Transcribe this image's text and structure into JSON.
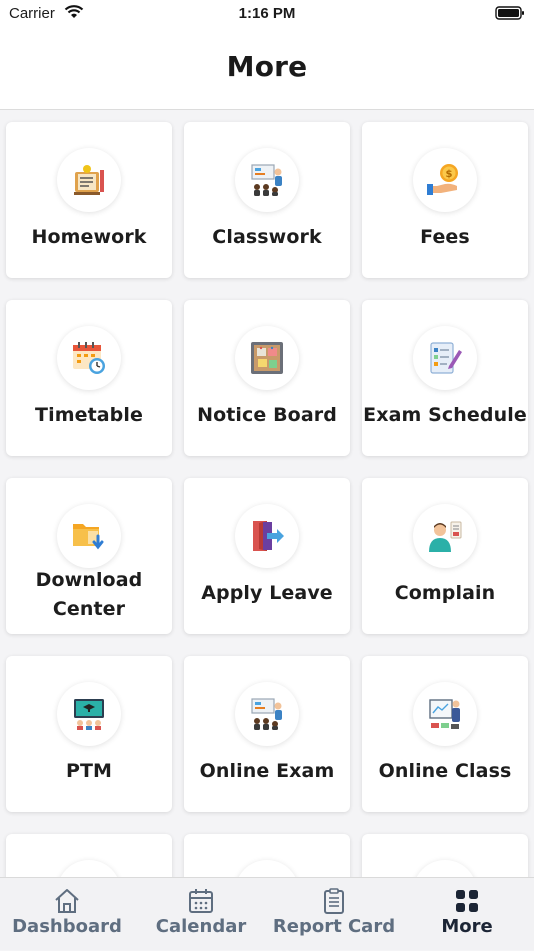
{
  "status_bar": {
    "carrier": "Carrier",
    "time": "1:16 PM"
  },
  "header": {
    "title": "More"
  },
  "tiles": [
    {
      "label": "Homework",
      "icon": "homework-book-icon"
    },
    {
      "label": "Classwork",
      "icon": "classroom-board-icon"
    },
    {
      "label": "Fees",
      "icon": "hand-coin-icon"
    },
    {
      "label": "Timetable",
      "icon": "calendar-clock-icon"
    },
    {
      "label": "Notice Board",
      "icon": "pinboard-icon"
    },
    {
      "label": "Exam Schedule",
      "icon": "checklist-pencil-icon"
    },
    {
      "label_line1": "Download",
      "label_line2": "Center",
      "icon": "folder-download-icon"
    },
    {
      "label": "Apply Leave",
      "icon": "exit-door-icon"
    },
    {
      "label": "Complain",
      "icon": "person-complaint-icon"
    },
    {
      "label": "PTM",
      "icon": "meeting-screen-icon"
    },
    {
      "label": "Online Exam",
      "icon": "classroom-board-icon"
    },
    {
      "label": "Online Class",
      "icon": "teacher-whiteboard-icon"
    }
  ],
  "tabbar": {
    "items": [
      {
        "label": "Dashboard",
        "icon": "home-icon"
      },
      {
        "label": "Calendar",
        "icon": "calendar-icon"
      },
      {
        "label": "Report Card",
        "icon": "clipboard-list-icon"
      },
      {
        "label": "More",
        "icon": "grid-icon",
        "active": true
      }
    ]
  },
  "colors": {
    "accent": "#1c2535",
    "inactive_tab": "#5f6e80",
    "background": "#f4f4f6"
  }
}
